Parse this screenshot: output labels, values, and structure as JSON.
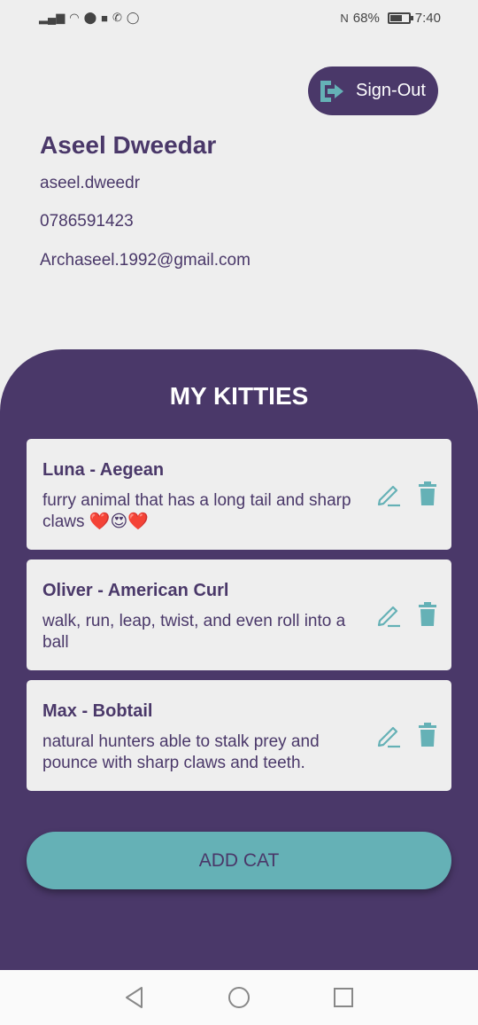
{
  "status_bar": {
    "battery": "68%",
    "time": "7:40",
    "icons": [
      "signal-icon",
      "wifi-icon",
      "app-icon",
      "linkedin-icon",
      "phone-icon",
      "whatsapp-icon",
      "nfc-icon",
      "battery-icon"
    ],
    "battery_level": 0.68
  },
  "header": {
    "signout_label": "Sign-Out",
    "signout_icon": "sign-out-icon"
  },
  "profile": {
    "name": "Aseel Dweedar",
    "username": "aseel.dweedr",
    "phone": "0786591423",
    "email": "Archaseel.1992@gmail.com"
  },
  "kitties": {
    "title": "MY KITTIES",
    "cards": [
      {
        "title": "Luna - Aegean",
        "description": "furry animal that has a long tail and sharp claws ❤️😍❤️"
      },
      {
        "title": "Oliver - American Curl",
        "description": "walk, run, leap, twist, and even roll into a ball"
      },
      {
        "title": "Max - Bobtail",
        "description": "natural hunters able to stalk prey and pounce with sharp claws and teeth."
      }
    ],
    "add_label": "ADD CAT"
  },
  "colors": {
    "primary": "#4a3869",
    "accent": "#65b1b6",
    "background": "#eeeeee",
    "card": "#eeeeee"
  }
}
